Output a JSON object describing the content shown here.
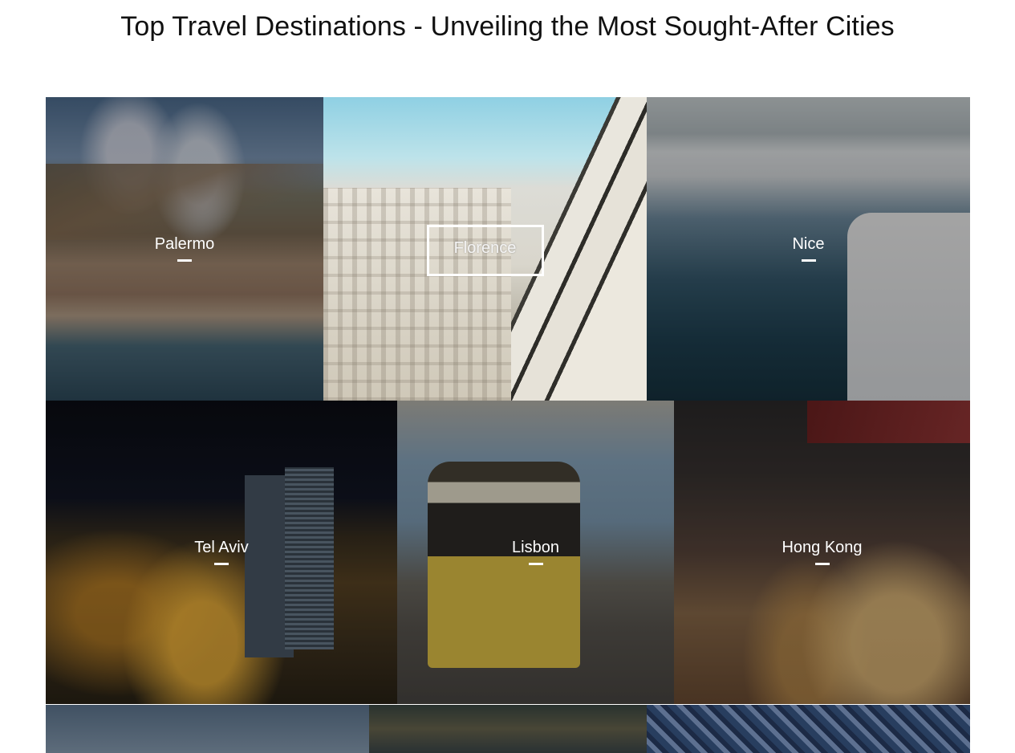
{
  "page": {
    "title": "Top Travel Destinations - Unveiling the Most Sought-After Cities"
  },
  "gallery": {
    "rows": [
      {
        "tiles": [
          {
            "name": "Palermo",
            "active": false
          },
          {
            "name": "Florence",
            "active": true
          },
          {
            "name": "Nice",
            "active": false
          }
        ]
      },
      {
        "tiles": [
          {
            "name": "Tel Aviv",
            "active": false
          },
          {
            "name": "Lisbon",
            "active": false
          },
          {
            "name": "Hong Kong",
            "active": false
          }
        ]
      }
    ]
  }
}
